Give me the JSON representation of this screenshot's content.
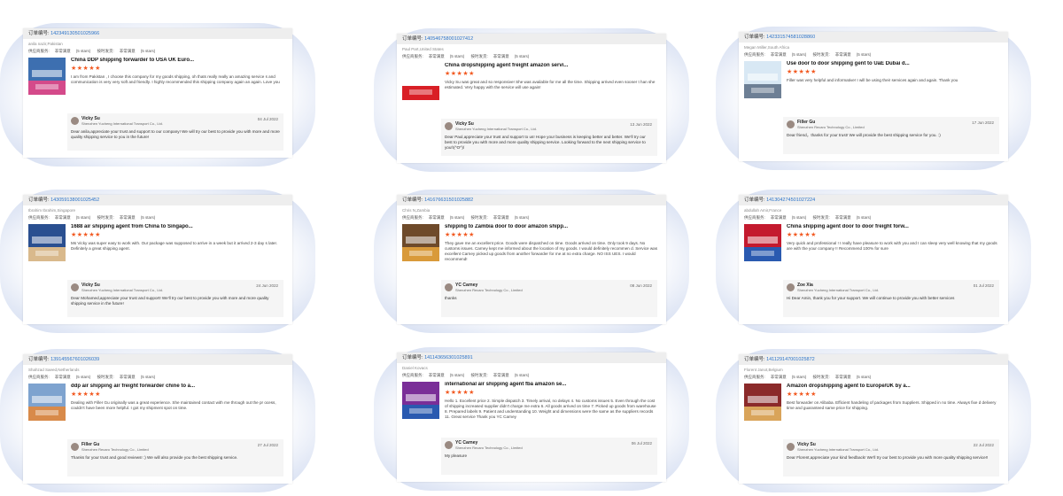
{
  "labels": {
    "order_prefix": "订单编号:",
    "supplier_service": "供应商服务:",
    "on_time": "按时发货:",
    "very_satisfied": "非常满意",
    "five_stars": "(5 stars)",
    "stars": "★★★★★"
  },
  "reviews": [
    {
      "order_no": "142349130501025966",
      "buyer": "anila nazir,Pakistan",
      "product_title": "China DDP shipping forwarder to USA UK Euro...",
      "review_text": "I am from Pakistan , I choose this company for my goods shipping, oh thats really really an amazing service s and communication is very very soft and friendly. I highly recommended this shipping company again an again. Love you",
      "replier": "Vicky Su",
      "reply_company": "Shenzhen Yucheng International Transport Co., Ltd.",
      "reply_date": "04 Jul 2022",
      "reply_text": "Dear anila,appreciate your trust and support to our company! We will try our best to provide you with more and more quality shipping service to you in the future!"
    },
    {
      "order_no": "140546758001027412",
      "buyer": "Paul Part,United States",
      "product_title": "China dropshipping agent freight amazon servi...",
      "review_text": "Vicky Su was great and so responsive! She was available for me all the time. Shipping arrived even sooner t han she estimated. Very happy with the service will use again!",
      "replier": "Vicky Su",
      "reply_company": "Shenzhen Yucheng International Transport Co., Ltd.",
      "reply_date": "13 Jun 2022",
      "reply_text": "Dear Paul,appreciate your trust and support to us! Hope your business is keeping better and better. We'll try our best to provide you with more and more quality shipping service. Looking forward to the next shipping service to you!\\(^O^)/"
    },
    {
      "order_no": "142331574581028860",
      "buyer": "Megan Miller,South Africa",
      "product_title": "Use door to door shipping gent to UaE Dubai d...",
      "review_text": "Filler was very helpful and informative! I will be using their services again and again. Thank you",
      "replier": "Filler Gu",
      "reply_company": "Shenzhen Recaro Technology Co., Limited",
      "reply_date": "17 Jun 2022",
      "reply_text": "Dear friend，thanks for your trust! We will provide the best shipping service for you. :)"
    },
    {
      "order_no": "143059138001025452",
      "buyer": "Ibrahim Ibrahim,Singapore",
      "product_title": "1688 air shipping agent from China to Singapo...",
      "review_text": "Ms Vicky was super easy to work with. Our package was supposed to arrive in a week but it arrived 2-3 day s later. Definitely a great shipping agent.",
      "replier": "Vicky Su",
      "reply_company": "Shenzhen Yucheng International Transport Co., Ltd.",
      "reply_date": "24 Jun 2022",
      "reply_text": "Dear Mohamed,appreciate your trust and support! We'll try our best to provide you with more and more quality shipping service in the future!"
    },
    {
      "order_no": "141676631501025882",
      "buyer": "Chris N,Zambia",
      "product_title": "shipping to Zambia door to door amazon shipp...",
      "review_text": "They gave me an excellent price. Goods were dispatched on time. Goods arrived on time. Only took 9 days. No customs issues. Carney kept me informed about the location of my goods. I would definitely recommen d. Service was excellent Carney picked up goods from another forwarder for me at no extra charge. NO ISS UES. I would recommend!",
      "replier": "YC Carney",
      "reply_company": "Shenzhen Recaro Technology Co., Limited",
      "reply_date": "08 Jun 2022",
      "reply_text": "thanks"
    },
    {
      "order_no": "141304274501027224",
      "buyer": "abdullah Amir,France",
      "product_title": "China shipping agent door to door freight forw...",
      "review_text": "Very quick and professional ! I really have pleasure to work with you and I can sleep very well knowing that my goods are with the your company !! Recommend 100% for sure",
      "replier": "Zoe Xia",
      "reply_company": "Shenzhen Yucheng International Transport Co., Ltd.",
      "reply_date": "01 Jul 2022",
      "reply_text": "Hi Dear Amin, thank you for your support. We will continue to provide you with better services"
    },
    {
      "order_no": "139145567601026039",
      "buyer": "Shahzad Saeed,Netherlands",
      "product_title": "ddp air shipping air freight forwarder chine to a...",
      "review_text": "Dealing with Filler Gu originally was a great experience. She maintained contact with me through out the pr ocess, couldn't have been more helpful. I got my shipment spot on time.",
      "replier": "Filler Gu",
      "reply_company": "Shenzhen Recaro Technology Co., Limited",
      "reply_date": "27 Jul 2022",
      "reply_text": "Thanks for your trust and good reviews! :) We will also provide you the best shipping service."
    },
    {
      "order_no": "141143656301025891",
      "buyer": "Daniel Kovacs",
      "product_title": "international air shipping agent fba amazon se...",
      "review_text": "Hello 1. Excellent price 2. Simple dispatch 3. Timely arrival, no delays 4. No customs issues 5. Even through the cost of shipping increased supplier didn't charge me extra 6. All goods arrived on time 7. Picked up goods from warehouse 8. Prepared labels 9. Patient and understanding 10. Weight and dimensions were the same as the suppliers records 11. Great service Thank you YC Carney",
      "replier": "YC Carney",
      "reply_company": "Shenzhen Recaro Technology Co., Limited",
      "reply_date": "06 Jul 2022",
      "reply_text": "My pleasure"
    },
    {
      "order_no": "141129147001025872",
      "buyer": "Florent Janot,Belgium",
      "product_title": "Amazon dropshipping agent to Europe/UK by a...",
      "review_text": "Best forwarder on Alibaba. Efficient handeling of packages from Suppliers. Shipped in no time. Always fixe d delivery time and guaranteed same price for shipping.",
      "replier": "Vicky Su",
      "reply_company": "Shenzhen Yucheng International Transport Co., Ltd.",
      "reply_date": "22 Jul 2022",
      "reply_text": "Dear Florent,appreciate your kind feedback! We'll try our best to provide you with more quality shipping service!!"
    }
  ]
}
